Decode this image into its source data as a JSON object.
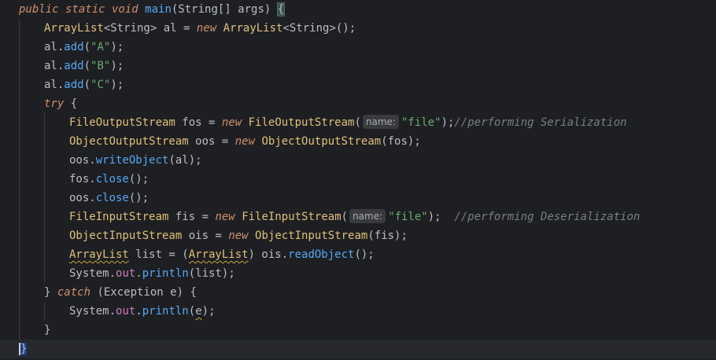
{
  "editor": {
    "language": "java",
    "lines": [
      {
        "indent": 0,
        "tokens": [
          {
            "t": "public static void",
            "c": "kw"
          },
          {
            "t": " ",
            "c": ""
          },
          {
            "t": "main",
            "c": "fn"
          },
          {
            "t": "(String[] ",
            "c": ""
          },
          {
            "t": "args",
            "c": "param"
          },
          {
            "t": ") ",
            "c": ""
          },
          {
            "t": "{",
            "c": "brace-hl"
          }
        ]
      },
      {
        "indent": 1,
        "tokens": [
          {
            "t": "ArrayList",
            "c": "cls"
          },
          {
            "t": "<String> al = ",
            "c": ""
          },
          {
            "t": "new",
            "c": "kw"
          },
          {
            "t": " ",
            "c": ""
          },
          {
            "t": "ArrayList",
            "c": "cls"
          },
          {
            "t": "<String>();",
            "c": ""
          }
        ]
      },
      {
        "indent": 1,
        "tokens": [
          {
            "t": "al.",
            "c": ""
          },
          {
            "t": "add",
            "c": "fn"
          },
          {
            "t": "(",
            "c": ""
          },
          {
            "t": "\"A\"",
            "c": "str"
          },
          {
            "t": ");",
            "c": ""
          }
        ]
      },
      {
        "indent": 1,
        "tokens": [
          {
            "t": "al.",
            "c": ""
          },
          {
            "t": "add",
            "c": "fn"
          },
          {
            "t": "(",
            "c": ""
          },
          {
            "t": "\"B\"",
            "c": "str"
          },
          {
            "t": ");",
            "c": ""
          }
        ]
      },
      {
        "indent": 1,
        "tokens": [
          {
            "t": "al.",
            "c": ""
          },
          {
            "t": "add",
            "c": "fn"
          },
          {
            "t": "(",
            "c": ""
          },
          {
            "t": "\"C\"",
            "c": "str"
          },
          {
            "t": ");",
            "c": ""
          }
        ]
      },
      {
        "indent": 1,
        "tokens": [
          {
            "t": "try",
            "c": "kw"
          },
          {
            "t": " {",
            "c": ""
          }
        ]
      },
      {
        "indent": 2,
        "tokens": [
          {
            "t": "FileOutputStream",
            "c": "cls"
          },
          {
            "t": " fos = ",
            "c": ""
          },
          {
            "t": "new",
            "c": "kw"
          },
          {
            "t": " ",
            "c": ""
          },
          {
            "t": "FileOutputStream",
            "c": "cls"
          },
          {
            "t": "(",
            "c": ""
          },
          {
            "t": "name:",
            "c": "hint"
          },
          {
            "t": "\"file\"",
            "c": "str"
          },
          {
            "t": ");",
            "c": ""
          },
          {
            "t": "//performing Serialization",
            "c": "cm"
          }
        ]
      },
      {
        "indent": 2,
        "tokens": [
          {
            "t": "ObjectOutputStream",
            "c": "cls"
          },
          {
            "t": " oos = ",
            "c": ""
          },
          {
            "t": "new",
            "c": "kw"
          },
          {
            "t": " ",
            "c": ""
          },
          {
            "t": "ObjectOutputStream",
            "c": "cls"
          },
          {
            "t": "(fos);",
            "c": ""
          }
        ]
      },
      {
        "indent": 2,
        "tokens": [
          {
            "t": "oos.",
            "c": ""
          },
          {
            "t": "writeObject",
            "c": "fn"
          },
          {
            "t": "(al);",
            "c": ""
          }
        ]
      },
      {
        "indent": 2,
        "tokens": [
          {
            "t": "fos.",
            "c": ""
          },
          {
            "t": "close",
            "c": "fn"
          },
          {
            "t": "();",
            "c": ""
          }
        ]
      },
      {
        "indent": 2,
        "tokens": [
          {
            "t": "oos.",
            "c": ""
          },
          {
            "t": "close",
            "c": "fn"
          },
          {
            "t": "();",
            "c": ""
          }
        ]
      },
      {
        "indent": 2,
        "tokens": [
          {
            "t": "FileInputStream",
            "c": "cls"
          },
          {
            "t": " fis = ",
            "c": ""
          },
          {
            "t": "new",
            "c": "kw"
          },
          {
            "t": " ",
            "c": ""
          },
          {
            "t": "FileInputStream",
            "c": "cls"
          },
          {
            "t": "(",
            "c": ""
          },
          {
            "t": "name:",
            "c": "hint"
          },
          {
            "t": "\"file\"",
            "c": "str"
          },
          {
            "t": ");  ",
            "c": ""
          },
          {
            "t": "//performing Deserialization",
            "c": "cm"
          }
        ]
      },
      {
        "indent": 2,
        "tokens": [
          {
            "t": "ObjectInputStream",
            "c": "cls"
          },
          {
            "t": " ois = ",
            "c": ""
          },
          {
            "t": "new",
            "c": "kw"
          },
          {
            "t": " ",
            "c": ""
          },
          {
            "t": "ObjectInputStream",
            "c": "cls"
          },
          {
            "t": "(fis);",
            "c": ""
          }
        ]
      },
      {
        "indent": 2,
        "tokens": [
          {
            "t": "ArrayList",
            "c": "cls warn"
          },
          {
            "t": " list = (",
            "c": ""
          },
          {
            "t": "ArrayList",
            "c": "cls warn"
          },
          {
            "t": ") ois.",
            "c": ""
          },
          {
            "t": "readObject",
            "c": "fn"
          },
          {
            "t": "();",
            "c": ""
          }
        ]
      },
      {
        "indent": 2,
        "tokens": [
          {
            "t": "System.",
            "c": ""
          },
          {
            "t": "out",
            "c": "fld"
          },
          {
            "t": ".",
            "c": ""
          },
          {
            "t": "println",
            "c": "fn"
          },
          {
            "t": "(list);",
            "c": ""
          }
        ]
      },
      {
        "indent": 1,
        "tokens": [
          {
            "t": "} ",
            "c": ""
          },
          {
            "t": "catch",
            "c": "kw"
          },
          {
            "t": " (Exception ",
            "c": ""
          },
          {
            "t": "e",
            "c": "param"
          },
          {
            "t": ") {",
            "c": ""
          }
        ]
      },
      {
        "indent": 2,
        "tokens": [
          {
            "t": "System.",
            "c": ""
          },
          {
            "t": "out",
            "c": "fld"
          },
          {
            "t": ".",
            "c": ""
          },
          {
            "t": "println",
            "c": "fn"
          },
          {
            "t": "(",
            "c": ""
          },
          {
            "t": "e",
            "c": "param warn"
          },
          {
            "t": ");",
            "c": ""
          }
        ]
      },
      {
        "indent": 1,
        "tokens": [
          {
            "t": "}",
            "c": ""
          }
        ]
      },
      {
        "indent": 0,
        "current": true,
        "tokens": [
          {
            "t": "}",
            "c": "caret-brace"
          }
        ]
      }
    ]
  }
}
